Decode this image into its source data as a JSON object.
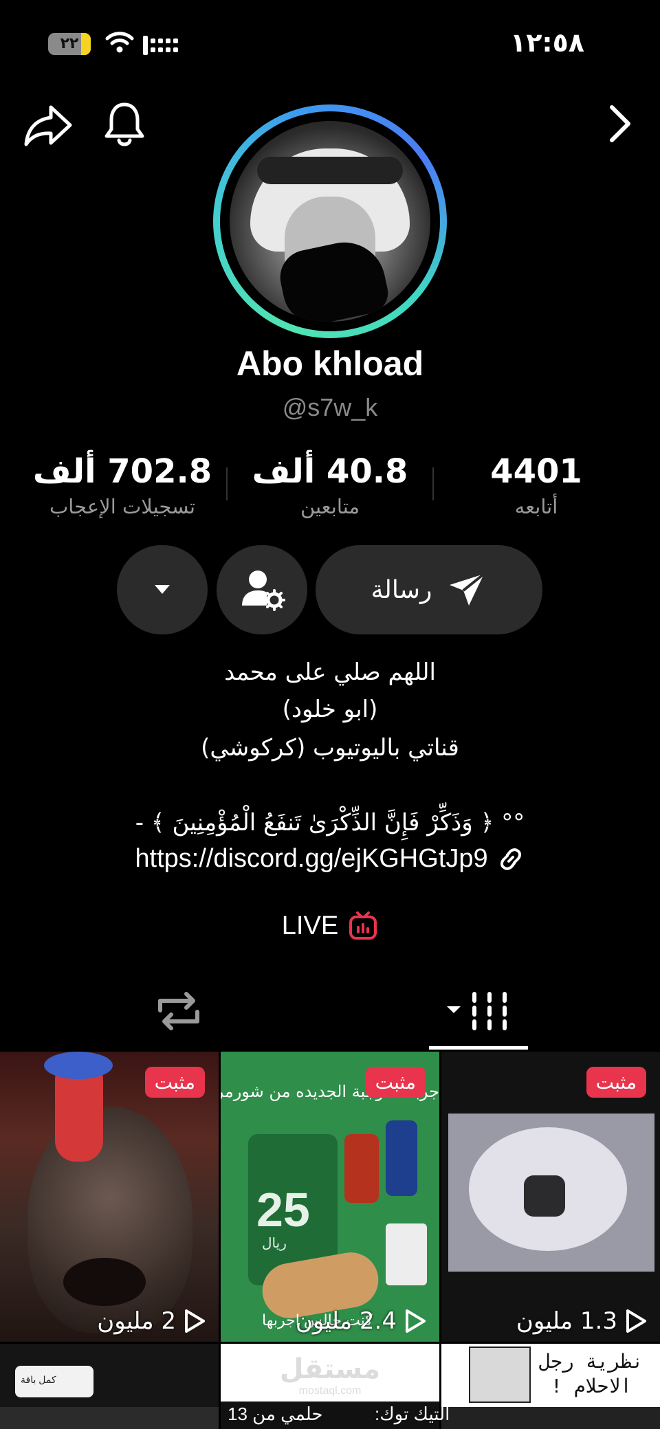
{
  "status_bar": {
    "time": "١٢:٥٨",
    "battery": "٢٢",
    "battery_level": 0.22
  },
  "profile": {
    "display_name": "Abo khload",
    "username": "@s7w_k"
  },
  "stats": [
    {
      "value": "702.8 ألف",
      "label": "تسجيلات الإعجاب"
    },
    {
      "value": "40.8 ألف",
      "label": "متابعين"
    },
    {
      "value": "4401",
      "label": "أتابعه"
    }
  ],
  "actions": {
    "message_label": "رسالة"
  },
  "bio": {
    "lines": [
      "اللهم صلي على محمد",
      "(ابو خلود)",
      "قناتي باليوتيوب (كركوشي)"
    ],
    "verse": "°° ﴿ وَذَكِّرْ فَإِنَّ الذِّكْرَىٰ تَنفَعُ الْمُؤْمِنِينَ ﴾ -",
    "link": "https://discord.gg/ejKGHGtJp9",
    "live_label": "LIVE"
  },
  "videos": [
    {
      "pin": "مثبت",
      "views": "1.3 مليون"
    },
    {
      "pin": "مثبت",
      "views": "2.4 مليون",
      "caption": "جربت الوجبة الجديده من شورمر",
      "overlay": "كنت جالس اجربها",
      "promo": "25",
      "promo_sub": "ريال"
    },
    {
      "pin": "مثبت",
      "views": "2 مليون"
    }
  ],
  "second_row": [
    {
      "caption": "نظرية رجل الاحلام !"
    },
    {
      "caption": "حلمي من 13",
      "watermark": "مستقل",
      "watermark_sub": "mostaql.com"
    },
    {
      "caption": "كمل باقة"
    }
  ],
  "extra_captions": {
    "tiktok": "التيك توك:"
  },
  "colors": {
    "accent_red": "#e8344c",
    "button_bg": "#2b2b2b",
    "muted": "#8a8a8a"
  }
}
